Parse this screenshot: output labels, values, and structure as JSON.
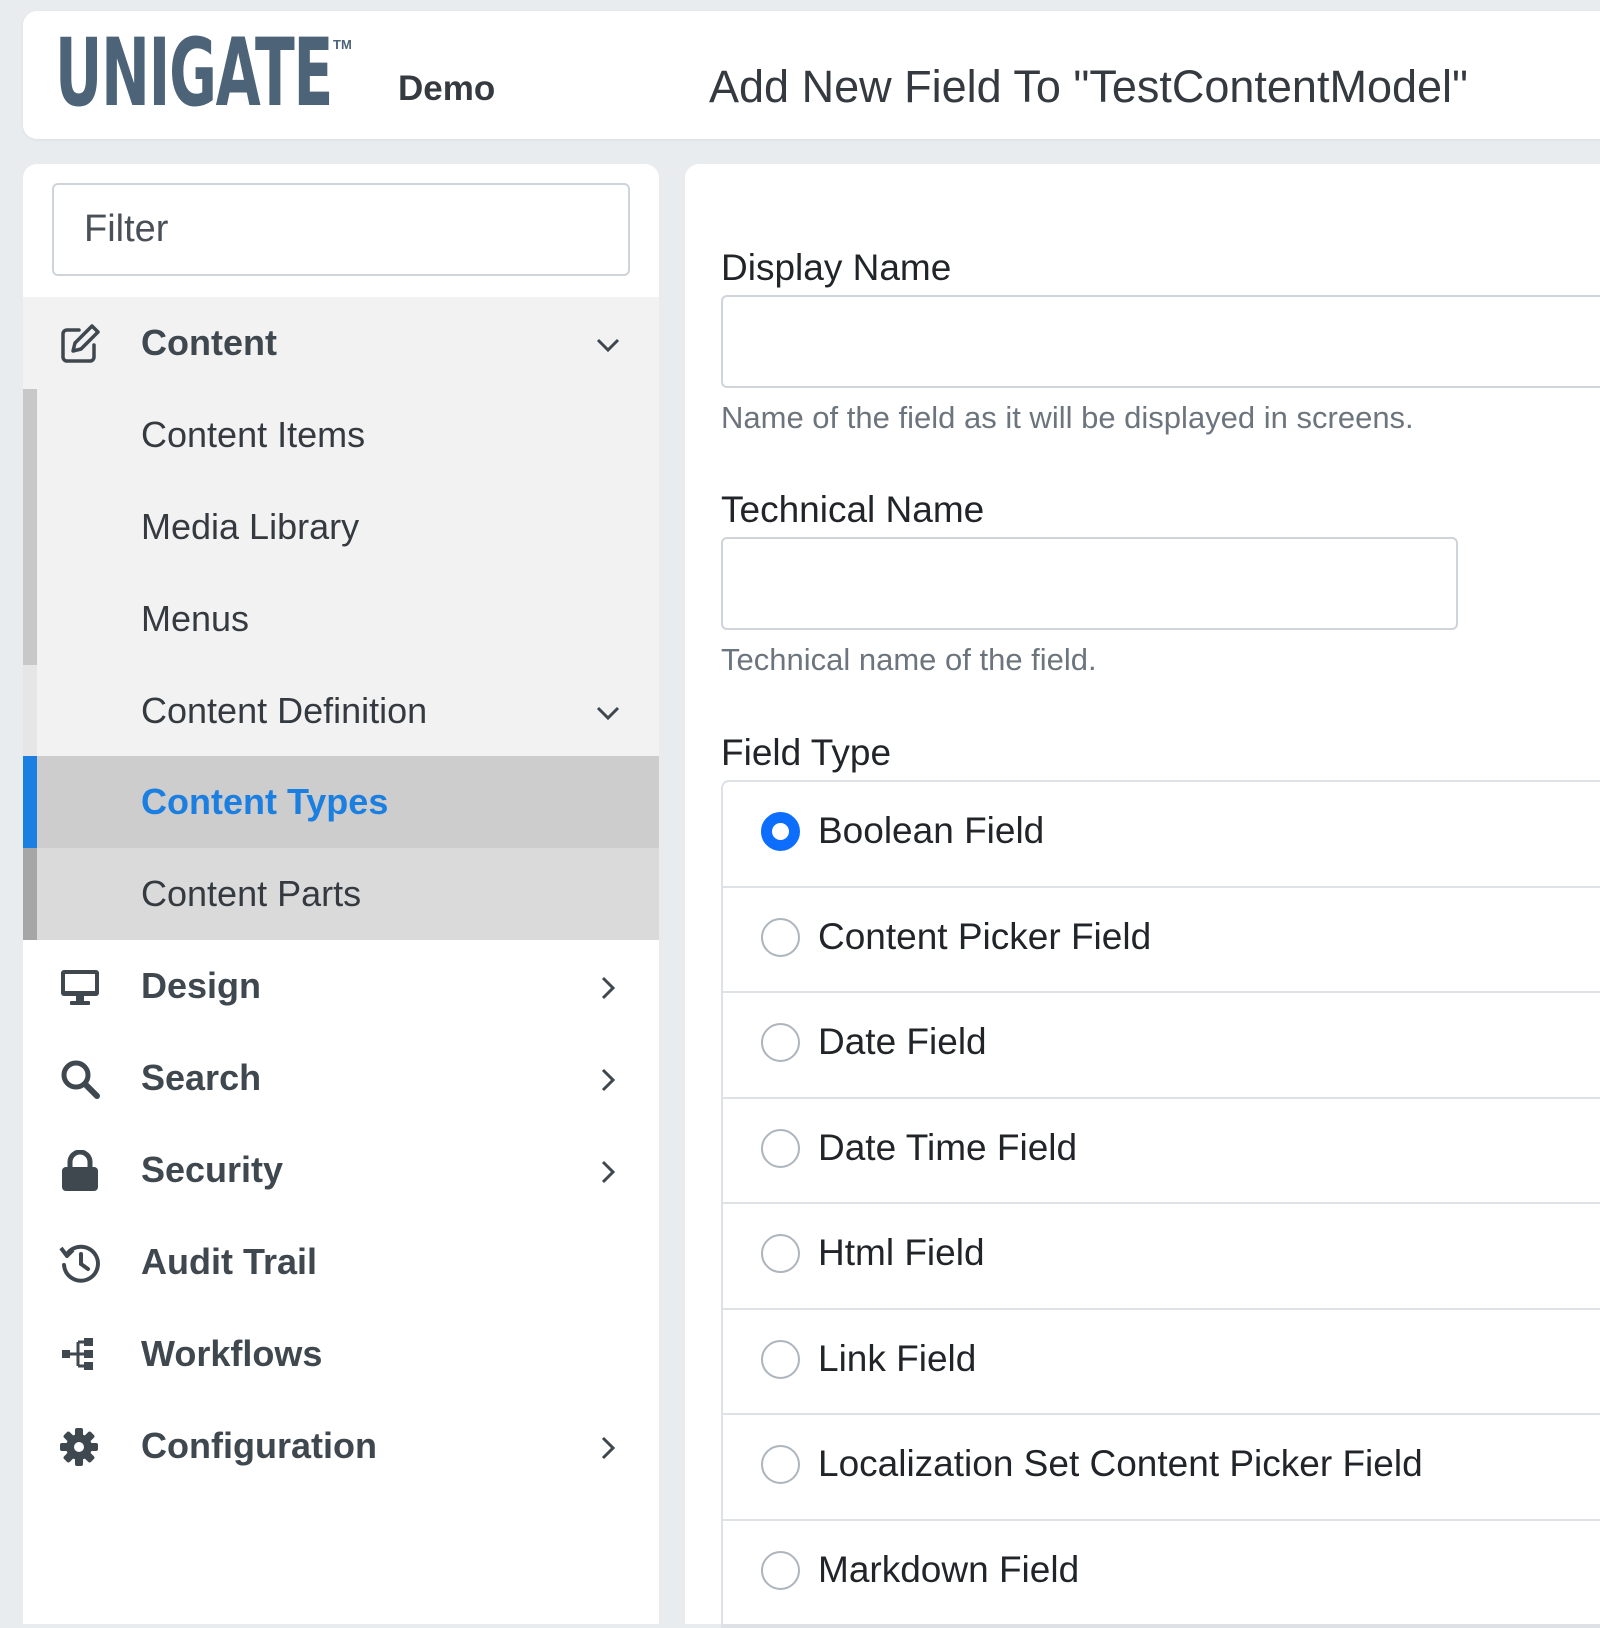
{
  "header": {
    "logo_text": "UNIGATE",
    "logo_tm": "TM",
    "tenant": "Demo",
    "title": "Add New Field To \"TestContentModel\""
  },
  "sidebar": {
    "filter_placeholder": "Filter",
    "content": {
      "label": "Content",
      "icon": "edit-icon",
      "expanded": true
    },
    "content_items": "Content Items",
    "media_library": "Media Library",
    "menus": "Menus",
    "content_definition": {
      "label": "Content Definition",
      "expanded": true
    },
    "content_types": {
      "label": "Content Types",
      "active": true
    },
    "content_parts": "Content Parts",
    "design": {
      "label": "Design",
      "icon": "monitor-icon"
    },
    "search": {
      "label": "Search",
      "icon": "search-icon"
    },
    "security": {
      "label": "Security",
      "icon": "lock-icon"
    },
    "audit_trail": {
      "label": "Audit Trail",
      "icon": "history-icon"
    },
    "workflows": {
      "label": "Workflows",
      "icon": "sitemap-icon"
    },
    "configuration": {
      "label": "Configuration",
      "icon": "gear-icon"
    }
  },
  "form": {
    "display_name": {
      "label": "Display Name",
      "value": "",
      "help": "Name of the field as it will be displayed in screens."
    },
    "technical_name": {
      "label": "Technical Name",
      "value": "",
      "help": "Technical name of the field."
    },
    "field_type": {
      "label": "Field Type",
      "selected": "Boolean Field",
      "options": [
        "Boolean Field",
        "Content Picker Field",
        "Date Field",
        "Date Time Field",
        "Html Field",
        "Link Field",
        "Localization Set Content Picker Field",
        "Markdown Field"
      ]
    }
  },
  "colors": {
    "accent": "#0d6efd",
    "active_text": "#1a7fe0",
    "logo": "#4c6378"
  }
}
